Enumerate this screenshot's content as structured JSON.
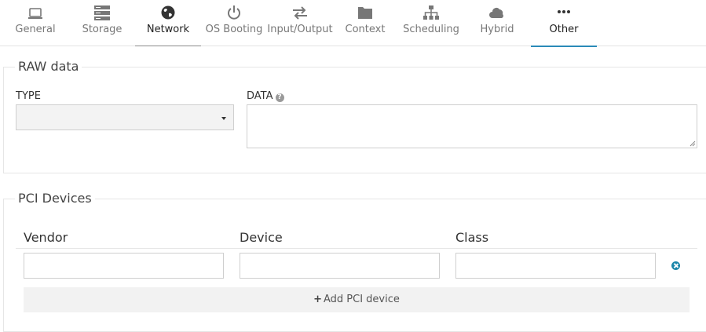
{
  "tabs": [
    {
      "label": "General",
      "icon": "laptop-icon"
    },
    {
      "label": "Storage",
      "icon": "server-icon"
    },
    {
      "label": "Network",
      "icon": "globe-icon"
    },
    {
      "label": "OS Booting",
      "icon": "power-icon"
    },
    {
      "label": "Input/Output",
      "icon": "exchange-icon"
    },
    {
      "label": "Context",
      "icon": "folder-icon"
    },
    {
      "label": "Scheduling",
      "icon": "sitemap-icon"
    },
    {
      "label": "Hybrid",
      "icon": "cloud-icon"
    },
    {
      "label": "Other",
      "icon": "ellipsis-icon"
    }
  ],
  "raw": {
    "legend": "RAW data",
    "type_label": "TYPE",
    "type_value": "",
    "data_label": "DATA",
    "data_value": ""
  },
  "pci": {
    "legend": "PCI Devices",
    "columns": [
      "Vendor",
      "Device",
      "Class"
    ],
    "row": {
      "vendor": "",
      "device": "",
      "class": ""
    },
    "add_label": "Add PCI device"
  },
  "colors": {
    "accent": "#2a8ab8",
    "remove": "#1b86a9"
  }
}
